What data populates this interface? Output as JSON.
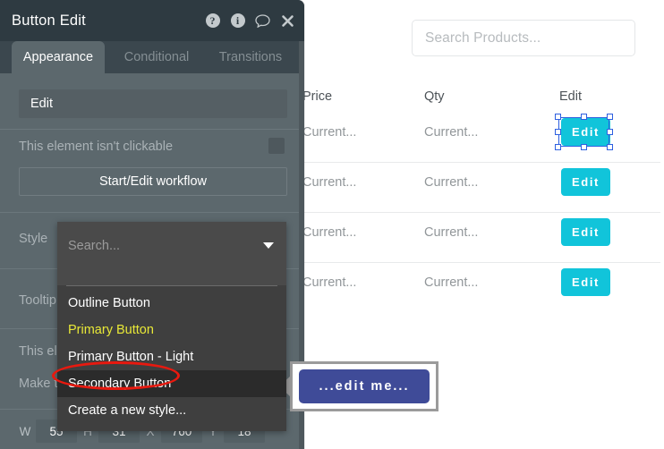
{
  "canvas": {
    "search": {
      "placeholder": "Search Products..."
    },
    "table": {
      "headers": [
        "Price",
        "Qty",
        "Edit"
      ],
      "rows": [
        {
          "price": "Current...",
          "qty": "Current...",
          "edit_label": "Edit",
          "selected": true
        },
        {
          "price": "Current...",
          "qty": "Current...",
          "edit_label": "Edit",
          "selected": false
        },
        {
          "price": "Current...",
          "qty": "Current...",
          "edit_label": "Edit",
          "selected": false
        },
        {
          "price": "Current...",
          "qty": "Current...",
          "edit_label": "Edit",
          "selected": false
        }
      ]
    },
    "preview_popup": {
      "button_label": "...edit me..."
    },
    "colors": {
      "edit_button": "#11c4da",
      "preview_button": "#3f4b98",
      "selection_handle_border": "#2d5fe0"
    }
  },
  "panel": {
    "title": "Button Edit",
    "header_icons": [
      {
        "name": "help-icon",
        "glyph": "?"
      },
      {
        "name": "info-icon",
        "glyph": "i"
      },
      {
        "name": "comment-icon",
        "glyph": "speech-bubble"
      },
      {
        "name": "close-icon",
        "glyph": "✕"
      }
    ],
    "tabs": [
      {
        "label": "Appearance",
        "active": true
      },
      {
        "label": "Conditional",
        "active": false
      },
      {
        "label": "Transitions",
        "active": false
      }
    ],
    "text_field_value": "Edit",
    "not_clickable_label": "This element isn't clickable",
    "workflow_button": "Start/Edit workflow",
    "labels": {
      "style": "Style",
      "tooltip": "Tooltip t",
      "this_element": "This elem",
      "make_this": "Make thi"
    },
    "position": {
      "w_label": "W",
      "w_value": "55",
      "h_label": "H",
      "h_value": "31",
      "x_label": "X",
      "x_value": "760",
      "y_label": "Y",
      "y_value": "18"
    }
  },
  "style_dropdown": {
    "search_placeholder": "Search...",
    "options": [
      {
        "label": "Outline Button",
        "state": "normal"
      },
      {
        "label": "Primary Button",
        "state": "yellow"
      },
      {
        "label": "Primary Button - Light",
        "state": "normal"
      },
      {
        "label": "Secondary Button",
        "state": "highlight"
      },
      {
        "label": "Create a new style...",
        "state": "normal"
      }
    ],
    "annotation_color": "#e8190f"
  }
}
